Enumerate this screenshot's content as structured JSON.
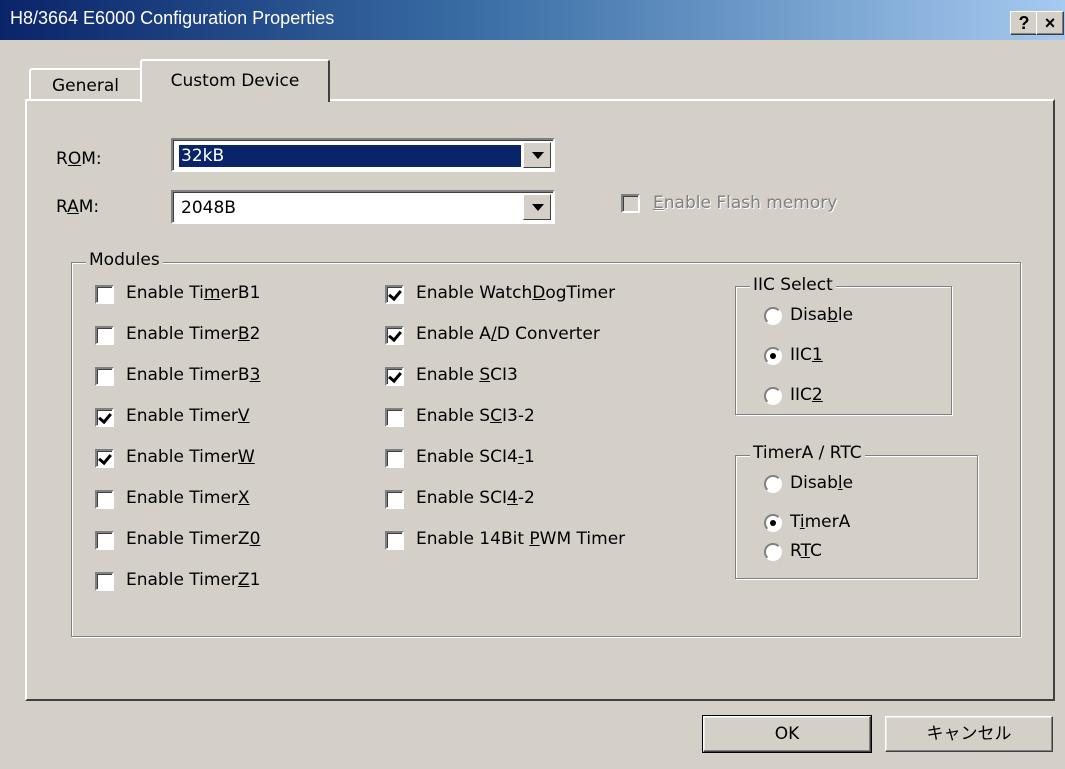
{
  "window": {
    "title": "H8/3664 E6000 Configuration Properties",
    "help_btn": "?",
    "close_btn": "×"
  },
  "tabs": [
    {
      "label": "General",
      "selected": false
    },
    {
      "label": "Custom Device",
      "selected": true
    }
  ],
  "rom": {
    "label_pre": "R",
    "label_key": "O",
    "label_post": "M:",
    "value": "32kB"
  },
  "ram": {
    "label_pre": "R",
    "label_key": "A",
    "label_post": "M:",
    "value": "2048B"
  },
  "flash": {
    "key": "E",
    "rest": "nable Flash memory",
    "checked": false,
    "enabled": false
  },
  "modules": {
    "legend": "Modules",
    "col1": [
      {
        "pre": "Enable Ti",
        "key": "m",
        "post": "erB1",
        "checked": false
      },
      {
        "pre": "Enable Timer",
        "key": "B",
        "post": "2",
        "checked": false
      },
      {
        "pre": "Enable TimerB",
        "key": "3",
        "post": "",
        "checked": false
      },
      {
        "pre": "Enable Timer",
        "key": "V",
        "post": "",
        "checked": true
      },
      {
        "pre": "Enable Timer",
        "key": "W",
        "post": "",
        "checked": true
      },
      {
        "pre": "Enable Timer",
        "key": "X",
        "post": "",
        "checked": false
      },
      {
        "pre": "Enable TimerZ",
        "key": "0",
        "post": "",
        "checked": false
      },
      {
        "pre": "Enable Timer",
        "key": "Z",
        "post": "1",
        "checked": false
      }
    ],
    "col2": [
      {
        "pre": "Enable Watch",
        "key": "D",
        "post": "ogTimer",
        "checked": true
      },
      {
        "pre": "Enable A",
        "key": "/",
        "post": "D Converter",
        "checked": true
      },
      {
        "pre": "Enable ",
        "key": "S",
        "post": "CI3",
        "checked": true
      },
      {
        "pre": "Enable S",
        "key": "C",
        "post": "I3-2",
        "checked": false
      },
      {
        "pre": "Enable SCI4",
        "key": "-",
        "post": "1",
        "checked": false
      },
      {
        "pre": "Enable SCI",
        "key": "4",
        "post": "-2",
        "checked": false
      },
      {
        "pre": "Enable 14Bit ",
        "key": "P",
        "post": "WM Timer",
        "checked": false
      }
    ]
  },
  "iic": {
    "legend": "IIC Select",
    "options": [
      {
        "pre": "Disa",
        "key": "b",
        "post": "le",
        "selected": false
      },
      {
        "pre": "IIC",
        "key": "1",
        "post": "",
        "selected": true
      },
      {
        "pre": "IIC",
        "key": "2",
        "post": "",
        "selected": false
      }
    ]
  },
  "timera": {
    "legend": "TimerA / RTC",
    "options": [
      {
        "pre": "Disab",
        "key": "l",
        "post": "e",
        "selected": false
      },
      {
        "pre": "T",
        "key": "i",
        "post": "merA",
        "selected": true
      },
      {
        "pre": "R",
        "key": "T",
        "post": "C",
        "selected": false
      }
    ]
  },
  "buttons": {
    "ok": "OK",
    "cancel": "キャンセル"
  }
}
